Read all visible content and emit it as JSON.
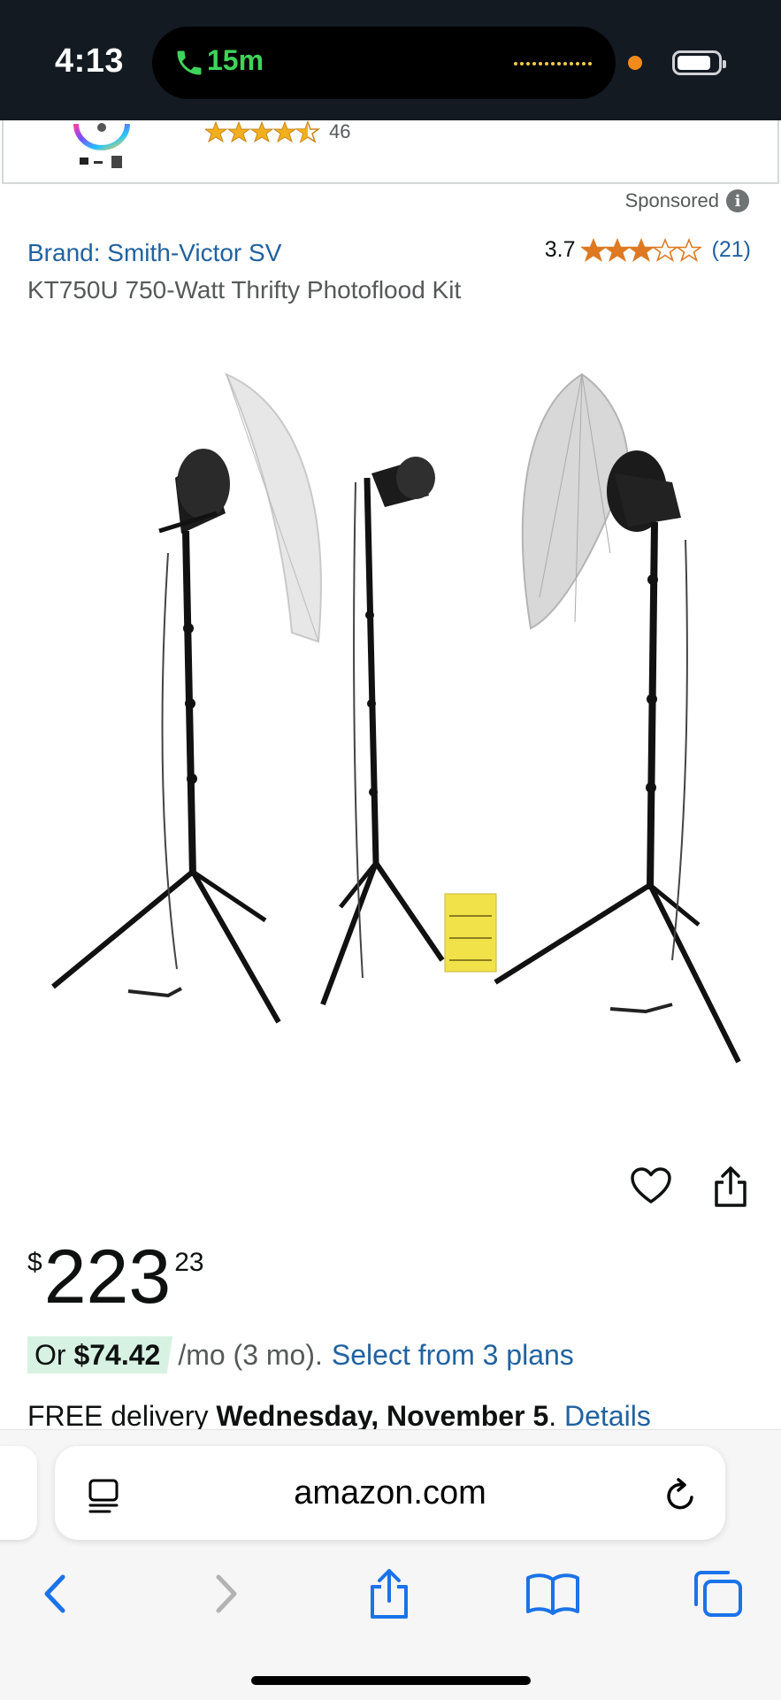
{
  "status_bar": {
    "time": "4:13",
    "call_duration": "15m",
    "icons": [
      "phone-call-icon",
      "audio-waveform-icon",
      "microphone-indicator-icon",
      "battery-icon"
    ]
  },
  "previous_item": {
    "review_count": "46",
    "rating_stars": 4.5
  },
  "sponsored_label": "Sponsored",
  "product": {
    "brand": "Brand: Smith-Victor SV",
    "rating": "3.7",
    "rating_stars": 3.7,
    "review_count": "(21)",
    "title": "KT750U 750-Watt Thrifty Photoflood Kit"
  },
  "price": {
    "currency": "$",
    "whole": "223",
    "fraction": "23"
  },
  "installments": {
    "prefix": "Or ",
    "amount": "$74.42",
    "suffix": " /mo (3 mo).",
    "link": "Select from 3 plans"
  },
  "delivery": {
    "prefix": "FREE delivery ",
    "date": "Wednesday, November 5",
    "separator": ". ",
    "link": "Details"
  },
  "browser": {
    "url": "amazon.com"
  },
  "colors": {
    "link": "#2162a1",
    "star": "#de7921",
    "status_bar_bg": "#131a22",
    "call_green": "#3fd35a",
    "installment_badge": "#d7f2e3",
    "safari_blue": "#1a73e8"
  }
}
